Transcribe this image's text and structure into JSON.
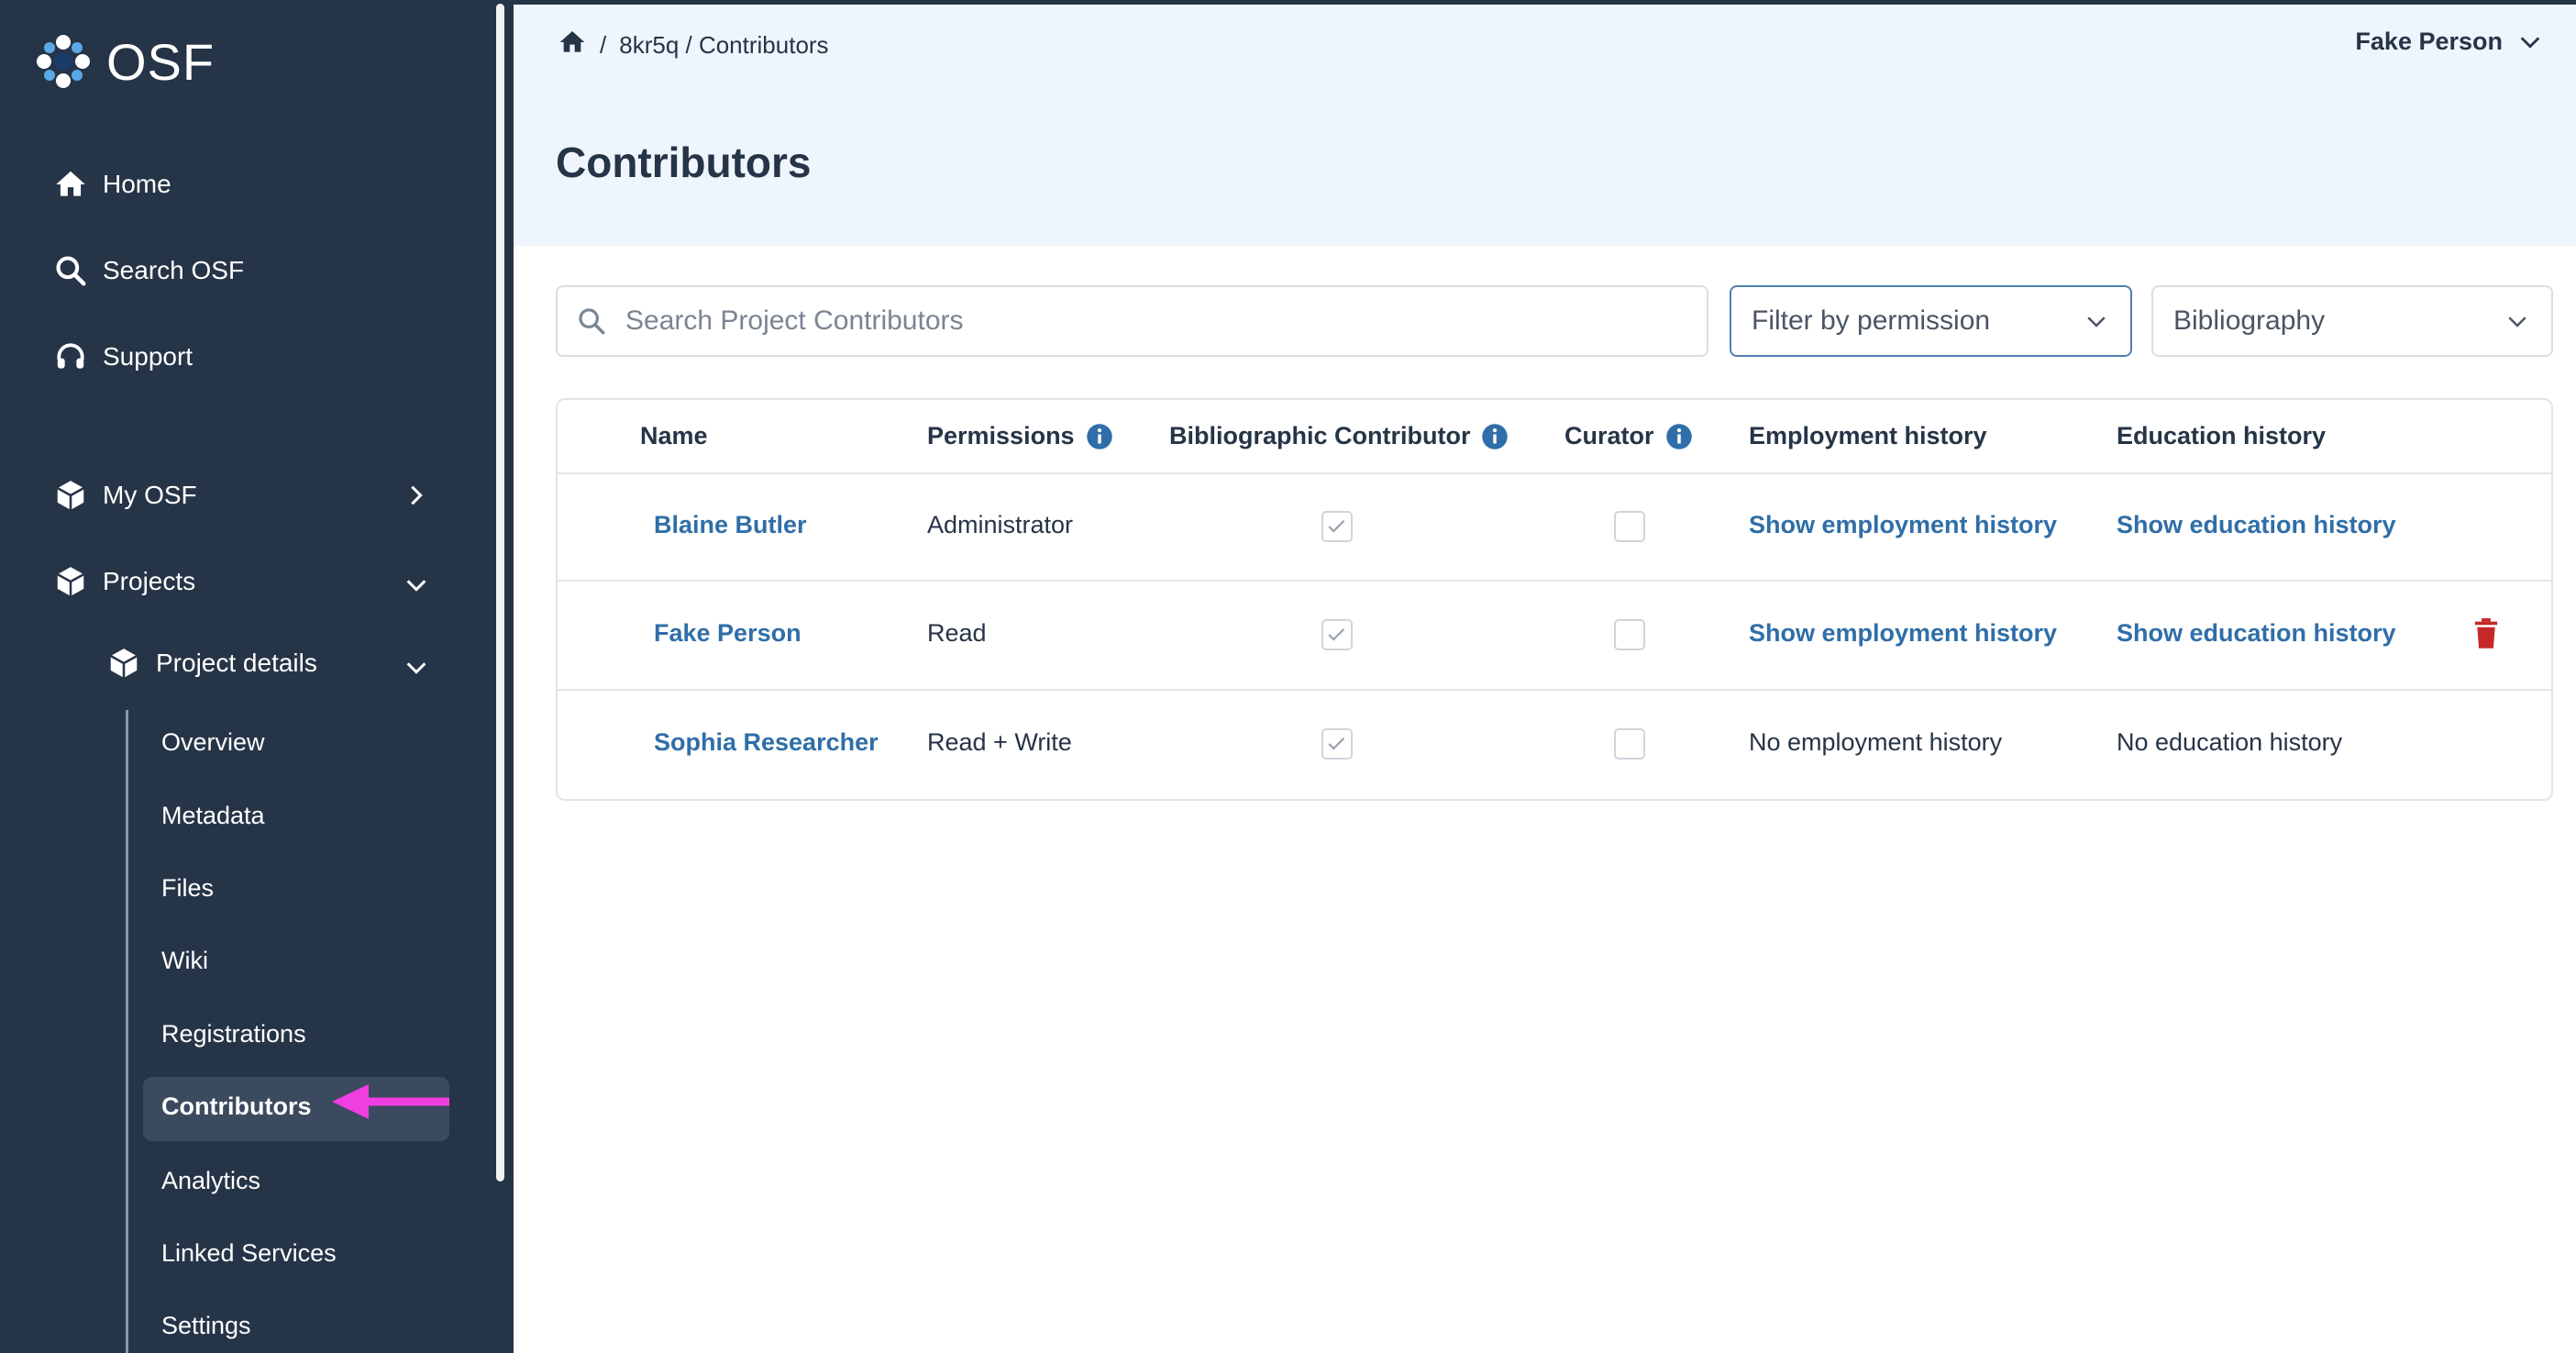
{
  "app": {
    "logo_text": "OSF"
  },
  "sidebar": {
    "items": [
      {
        "label": "Home"
      },
      {
        "label": "Search OSF"
      },
      {
        "label": "Support"
      },
      {
        "label": "My OSF"
      },
      {
        "label": "Projects"
      },
      {
        "label": "Project details"
      }
    ],
    "sub_items": [
      "Overview",
      "Metadata",
      "Files",
      "Wiki",
      "Registrations",
      "Contributors",
      "Analytics",
      "Linked Services",
      "Settings"
    ],
    "active": "Contributors"
  },
  "header": {
    "breadcrumb_sep": "/",
    "breadcrumb_path": "8kr5q / Contributors",
    "user_name": "Fake Person"
  },
  "page": {
    "title": "Contributors"
  },
  "controls": {
    "search_placeholder": "Search Project Contributors",
    "filter_label": "Filter by permission",
    "sort_label": "Bibliography"
  },
  "table": {
    "columns": [
      "Name",
      "Permissions",
      "Bibliographic Contributor",
      "Curator",
      "Employment history",
      "Education history"
    ],
    "rows": [
      {
        "name": "Blaine Butler",
        "permission": "Administrator",
        "bibliographic": true,
        "curator": false,
        "employment": "Show employment history",
        "education": "Show education history"
      },
      {
        "name": "Fake Person",
        "permission": "Read",
        "bibliographic": true,
        "curator": false,
        "employment": "Show employment history",
        "education": "Show education history"
      },
      {
        "name": "Sophia Researcher",
        "permission": "Read + Write",
        "bibliographic": true,
        "curator": false,
        "employment": "No employment history",
        "education": "No education history"
      }
    ]
  },
  "colors": {
    "sidebar_bg": "#263447",
    "link": "#2f6ea8",
    "accent_arrow": "#f03ee0",
    "delete": "#c62828"
  }
}
